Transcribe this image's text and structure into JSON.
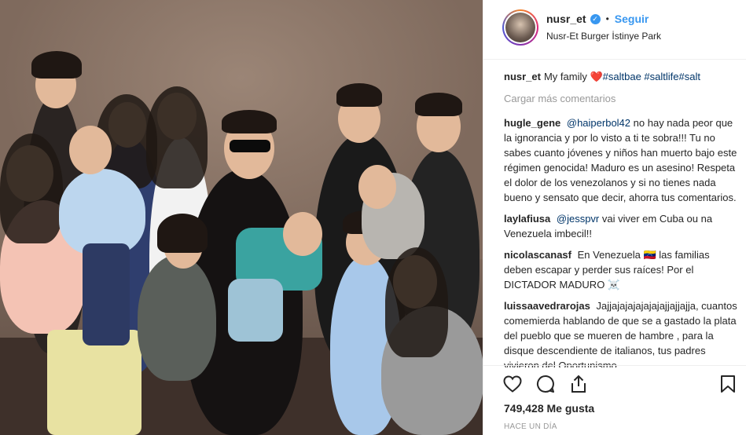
{
  "post": {
    "username": "nusr_et",
    "follow_label": "Seguir",
    "separator": "•",
    "location": "Nusr-Et Burger İstinye Park",
    "caption_user": "nusr_et",
    "caption_text": "My family",
    "caption_tags": "#saltbae #saltlife#salt",
    "load_more": "Cargar más comentarios",
    "likes": "749,428 Me gusta",
    "timestamp": "HACE UN DÍA"
  },
  "comments": [
    {
      "user": "hugle_gene",
      "mention": "@haiperbol42",
      "text": "no hay nada peor que la ignorancia y por lo visto a ti te sobra!!! Tu no sabes cuanto jóvenes y niños han muerto bajo este régimen genocida! Maduro es un asesino! Respeta el dolor de los venezolanos y si no tienes nada bueno y sensato que decir, ahorra tus comentarios."
    },
    {
      "user": "laylafiusa",
      "mention": "@jesspvr",
      "text": "vai viver em Cuba ou na Venezuela imbecil!!"
    },
    {
      "user": "nicolascanasf",
      "mention": "",
      "text": "En Venezuela 🇻🇪 las familias deben escapar y perder sus raíces! Por el DICTADOR MADURO ☠️"
    },
    {
      "user": "luissaavedrarojas",
      "mention": "",
      "text": "Jajjajajajajajajajjajjajja, cuantos comemierda hablando de que se a gastado la plata del pueblo que se mueren de hambre , para la disque descendiente de italianos, tus padres vivieron del Oportunismo"
    }
  ],
  "icons": {
    "verified": "verified-badge-icon",
    "like": "heart-outline-icon",
    "comment": "comment-bubble-icon",
    "share": "share-icon",
    "save": "bookmark-icon"
  },
  "colors": {
    "link": "#3897f0",
    "muted": "#999999",
    "text": "#262626",
    "tag": "#003569"
  }
}
